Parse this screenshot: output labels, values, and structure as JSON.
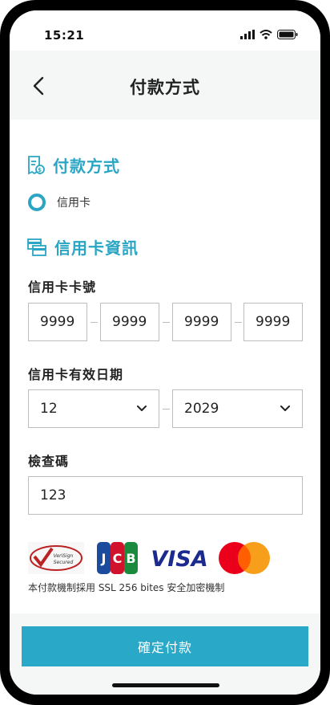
{
  "status_bar": {
    "time": "15:21"
  },
  "header": {
    "title": "付款方式"
  },
  "payment_method": {
    "section_title": "付款方式",
    "option_label": "信用卡"
  },
  "card_info": {
    "section_title": "信用卡資訊",
    "card_number_label": "信用卡卡號",
    "card_number_parts": [
      "9999",
      "9999",
      "9999",
      "9999"
    ],
    "expiry_label": "信用卡有效日期",
    "expiry_month": "12",
    "expiry_year": "2029",
    "cvv_label": "檢查碼",
    "cvv_value": "123"
  },
  "security": {
    "verisign_text": "VeriSign Secured",
    "jcb_text": "JCB",
    "visa_text": "VISA",
    "note": "本付款機制採用 SSL 256 bites 安全加密機制"
  },
  "footer": {
    "confirm_label": "確定付款"
  },
  "colors": {
    "accent": "#2aa6c4",
    "button": "#29a9c7",
    "border": "#bdbdbd"
  }
}
